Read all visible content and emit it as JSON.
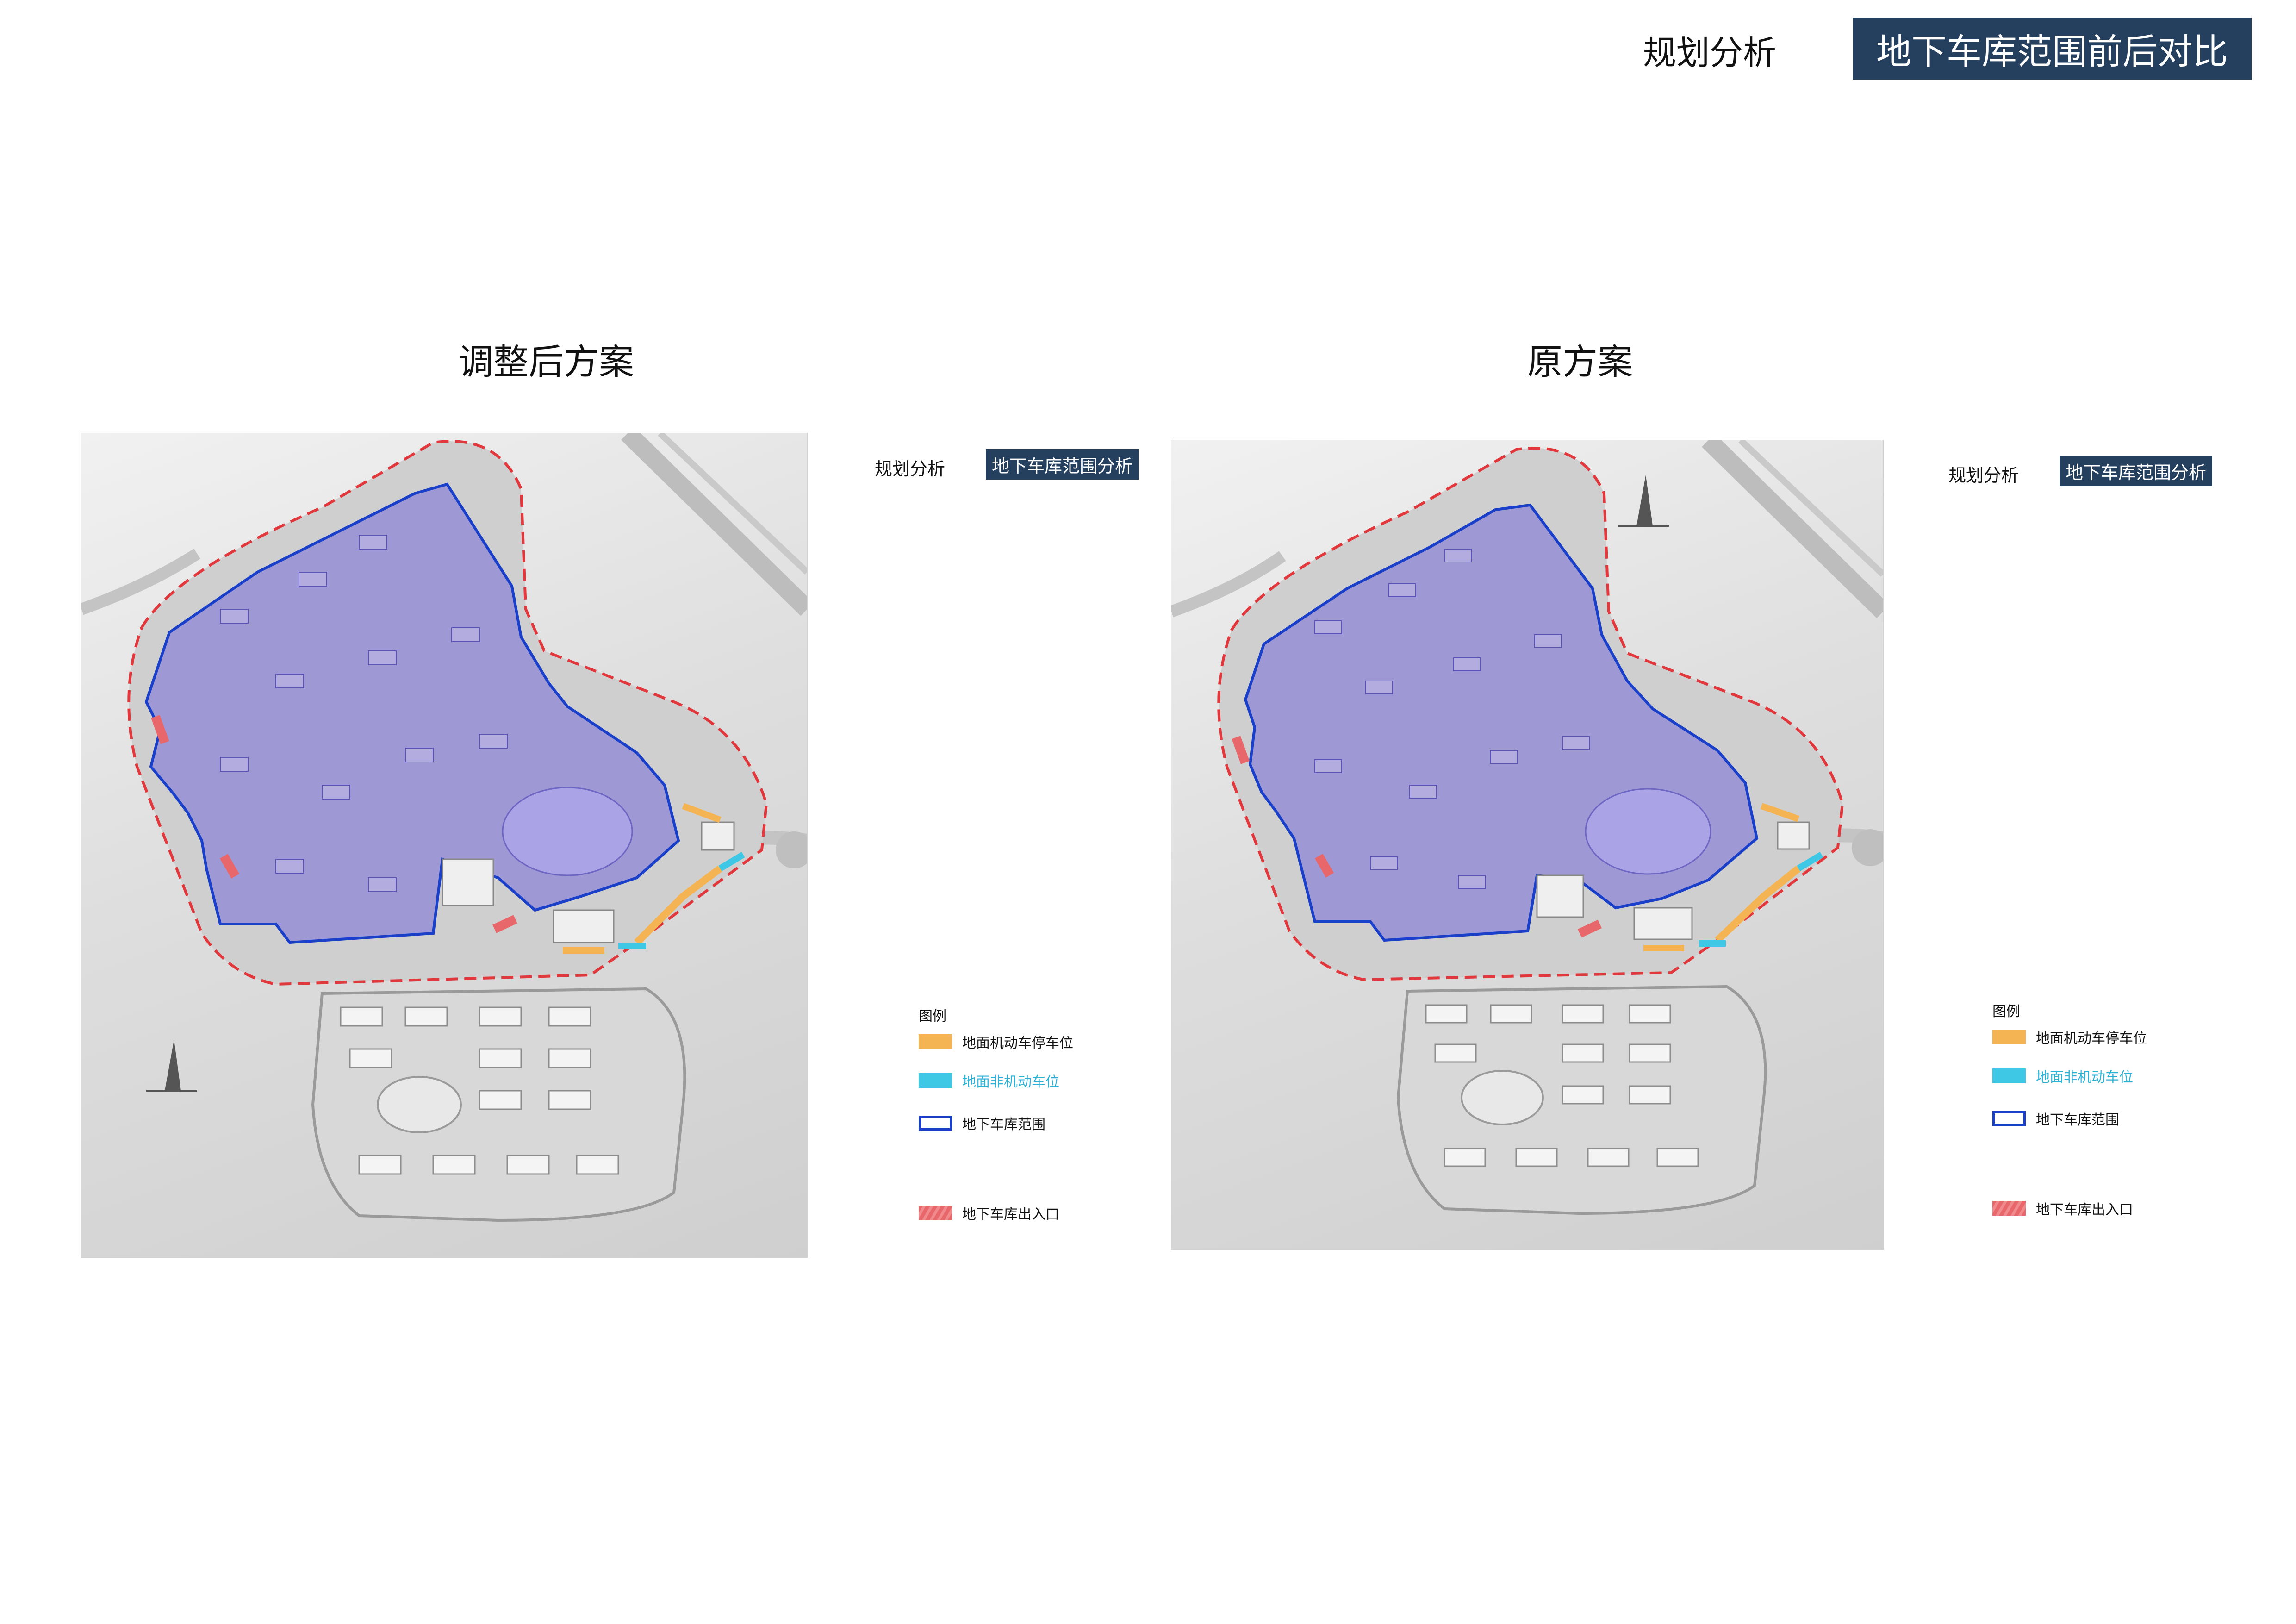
{
  "header": {
    "label": "规划分析",
    "badge": "地下车库范围前后对比"
  },
  "panels": [
    {
      "title": "调整后方案",
      "mini_label": "规划分析",
      "mini_badge": "地下车库范围分析",
      "legend": {
        "title": "图例",
        "items": [
          {
            "label": "地面机动车停车位",
            "swatch": "orange"
          },
          {
            "label": "地面非机动车位",
            "swatch": "cyan"
          },
          {
            "label": "地下车库范围",
            "swatch": "blue-outline"
          },
          {
            "label": "地下车库出入口",
            "swatch": "red-hatch"
          }
        ]
      }
    },
    {
      "title": "原方案",
      "mini_label": "规划分析",
      "mini_badge": "地下车库范围分析",
      "legend": {
        "title": "图例",
        "items": [
          {
            "label": "地面机动车停车位",
            "swatch": "orange"
          },
          {
            "label": "地面非机动车位",
            "swatch": "cyan"
          },
          {
            "label": "地下车库范围",
            "swatch": "blue-outline"
          },
          {
            "label": "地下车库出入口",
            "swatch": "red-hatch"
          }
        ]
      }
    }
  ],
  "colors": {
    "badge_bg": "#25405f",
    "garage_fill": "#8f88d6",
    "garage_outline": "#1a3fc8",
    "site_boundary": "#e0383c",
    "car_parking": "#f5b454",
    "bike_parking": "#3fc8e6",
    "entrance": "#e8676a"
  }
}
